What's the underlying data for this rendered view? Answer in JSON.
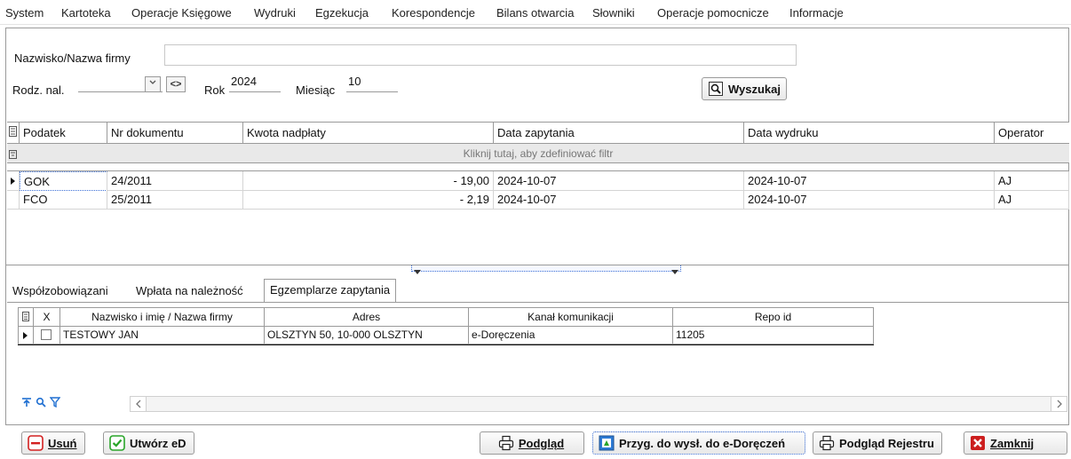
{
  "menu": [
    "System",
    "Kartoteka",
    "Operacje Księgowe",
    "Wydruki",
    "Egzekucja",
    "Korespondencje",
    "Bilans otwarcia",
    "Słowniki",
    "Operacje pomocnicze",
    "Informacje"
  ],
  "search": {
    "name_label": "Nazwisko/Nazwa firmy",
    "name_value": "",
    "rodz_label": "Rodz. nal.",
    "rodz_value": "",
    "rok_label": "Rok",
    "rok_value": "2024",
    "miesiac_label": "Miesiąc",
    "miesiac_value": "10",
    "search_button": "Wyszukaj"
  },
  "main_grid": {
    "columns": [
      "Podatek",
      "Nr dokumentu",
      "Kwota nadpłaty",
      "Data zapytania",
      "Data wydruku",
      "Operator"
    ],
    "filter_hint": "Kliknij tutaj, aby zdefiniować filtr",
    "rows": [
      {
        "podatek": "GOK",
        "nr": "24/2011",
        "kwota": "- 19,00",
        "data_zapytania": "2024-10-07",
        "data_wydruku": "2024-10-07",
        "operator": "AJ"
      },
      {
        "podatek": "FCO",
        "nr": "25/2011",
        "kwota": "- 2,19",
        "data_zapytania": "2024-10-07",
        "data_wydruku": "2024-10-07",
        "operator": "AJ"
      }
    ]
  },
  "tabs": [
    "Współzobowiązani",
    "Wpłata na należność",
    "Egzemplarze zapytania"
  ],
  "active_tab": "Egzemplarze zapytania",
  "detail_grid": {
    "columns": [
      "X",
      "Nazwisko i imię / Nazwa firmy",
      "Adres",
      "Kanał komunikacji",
      "Repo id"
    ],
    "rows": [
      {
        "checked": false,
        "nazwa": "TESTOWY JAN",
        "adres": "OLSZTYN 50, 10-000 OLSZTYN",
        "kanal": "e-Doręczenia",
        "repo": "11205"
      }
    ]
  },
  "buttons": {
    "usun": "Usuń",
    "utworz": "Utwórz eD",
    "podglad": "Podgląd",
    "przyg": "Przyg. do wysł. do e-Doręczeń",
    "podglad_rejestru": "Podgląd Rejestru",
    "zamknij": "Zamknij"
  },
  "colors": {
    "accent_blue": "#1f6fd1",
    "selection_dotted": "#3b6fd6",
    "delete_red": "#d32020",
    "create_green": "#2aa52a",
    "close_red": "#cc1e1e"
  }
}
